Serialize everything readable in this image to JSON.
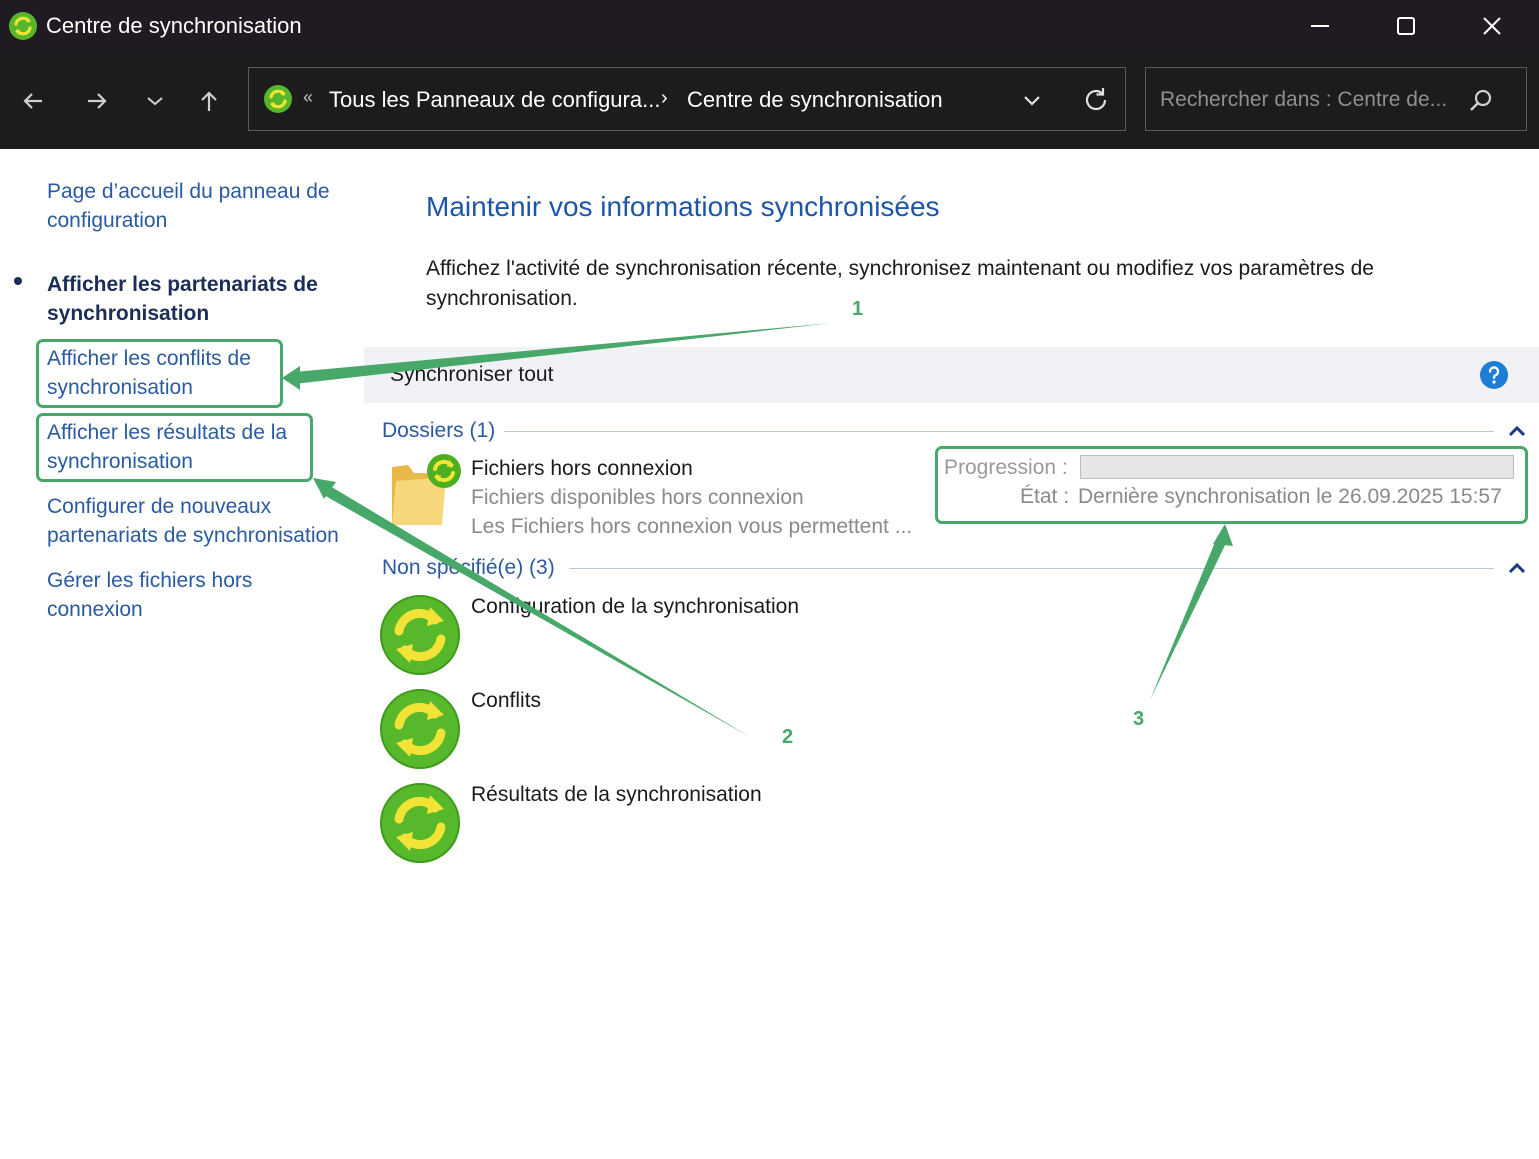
{
  "window": {
    "title": "Centre de synchronisation",
    "controls": [
      "minimize-icon",
      "maximize-icon",
      "close-icon"
    ]
  },
  "address_bar": {
    "overflow": "«",
    "segments": [
      "Tous les Panneaux de configura...",
      "Centre de synchronisation"
    ],
    "separator": "›"
  },
  "search": {
    "placeholder": "Rechercher dans : Centre de...",
    "value": ""
  },
  "sidebar": {
    "items": [
      {
        "label": "Page d’accueil du panneau de configuration",
        "selected": false
      },
      {
        "label": "Afficher les partenariats de synchronisation",
        "selected": true
      },
      {
        "label": "Afficher les conflits de synchronisation",
        "selected": false
      },
      {
        "label": "Afficher les résultats de la synchronisation",
        "selected": false
      },
      {
        "label": "Configurer de nouveaux partenariats de synchronisation",
        "selected": false
      },
      {
        "label": "Gérer les fichiers hors connexion",
        "selected": false
      }
    ]
  },
  "main": {
    "title": "Maintenir vos informations synchronisées",
    "description": "Affichez l'activité de synchronisation récente, synchronisez maintenant ou modifiez vos paramètres de synchronisation.",
    "toolbar": {
      "sync_all": "Synchroniser tout"
    },
    "groups": [
      {
        "header": "Dossiers (1)",
        "items": [
          {
            "title": "Fichiers hors connexion",
            "subtitle": "Fichiers disponibles hors connexion",
            "description": "Les Fichiers hors connexion vous permettent ...",
            "progress_label": "Progression :",
            "progress": 0,
            "state_label": "État :",
            "state_value": "Dernière synchronisation le 26.09.2025 15:57"
          }
        ]
      },
      {
        "header": "Non spécifié(e) (3)",
        "items": [
          {
            "title": "Configuration de la synchronisation"
          },
          {
            "title": "Conflits"
          },
          {
            "title": "Résultats de la synchronisation"
          }
        ]
      }
    ]
  },
  "annotations": {
    "labels": [
      "1",
      "2",
      "3"
    ],
    "color": "#48a86a"
  },
  "colors": {
    "link": "#2a5aa0",
    "title_blue": "#1d55a8",
    "sync_green": "#4caf1f",
    "titlebar": "#201b22",
    "navbar": "#1c1c1c"
  }
}
